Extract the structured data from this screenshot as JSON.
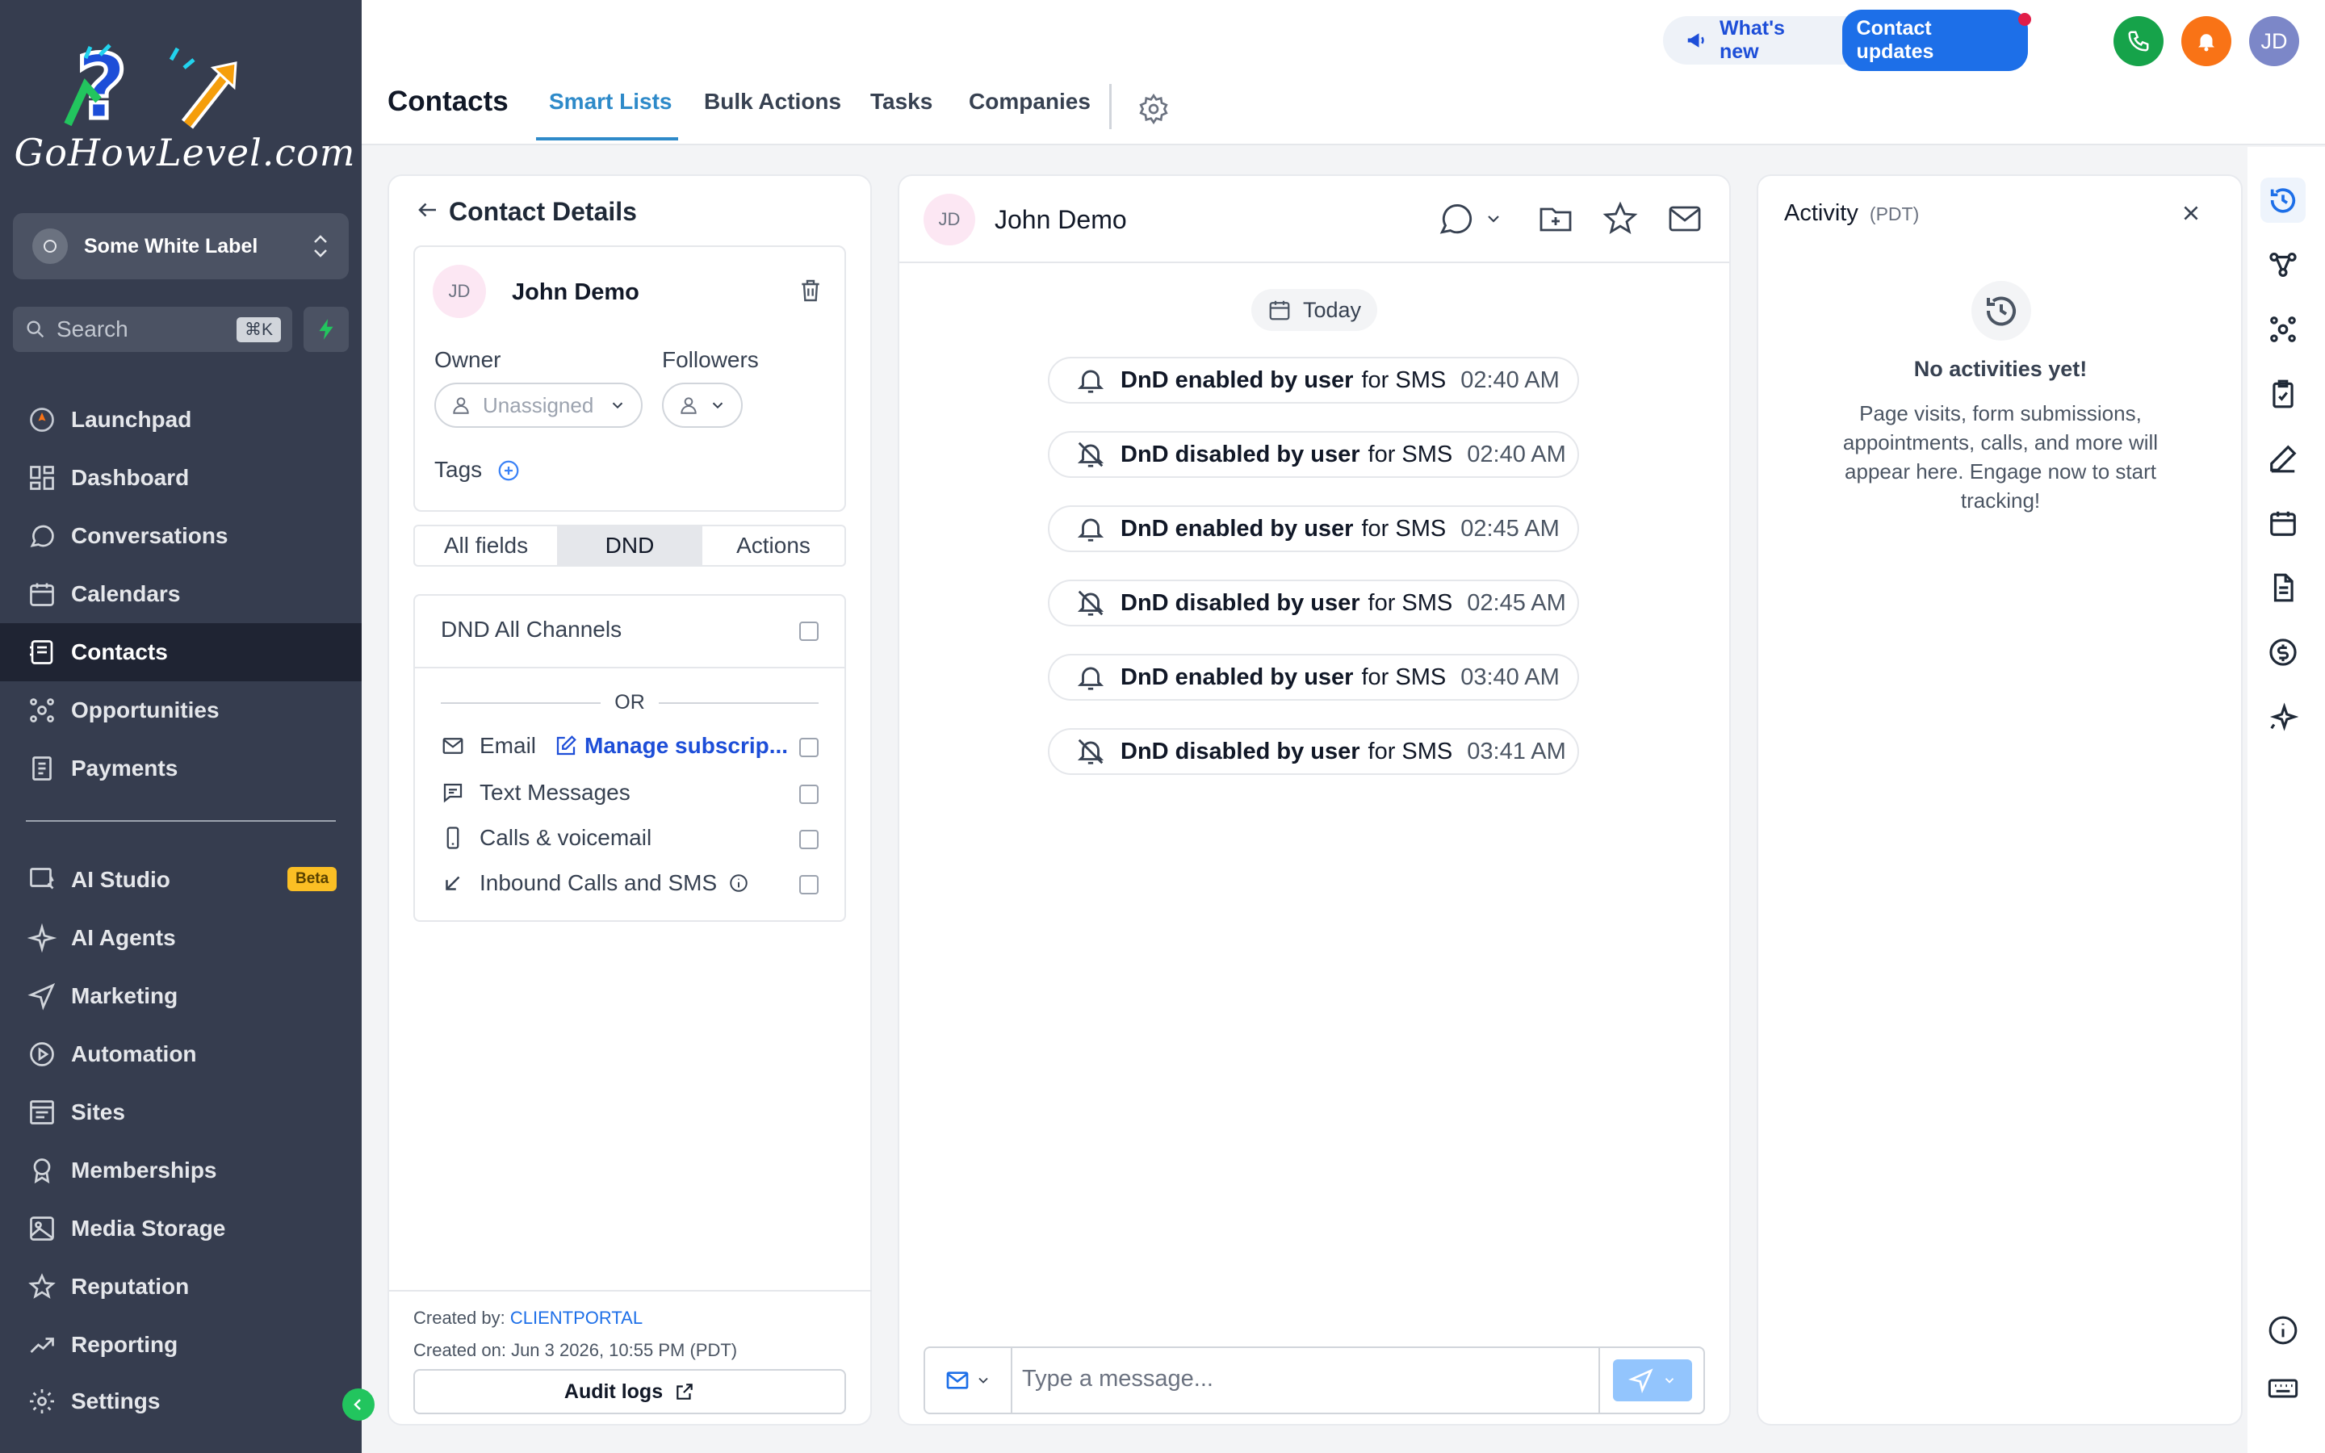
{
  "brand": {
    "logo_text": "GoHowLevel.com"
  },
  "sidebar": {
    "account": "Some White Label",
    "search_placeholder": "Search",
    "search_shortcut": "⌘K",
    "items": [
      {
        "label": "Launchpad",
        "icon": "rocket-icon"
      },
      {
        "label": "Dashboard",
        "icon": "grid-icon"
      },
      {
        "label": "Conversations",
        "icon": "chat-icon"
      },
      {
        "label": "Calendars",
        "icon": "calendar-icon"
      },
      {
        "label": "Contacts",
        "icon": "contacts-icon",
        "active": true
      },
      {
        "label": "Opportunities",
        "icon": "opportunities-icon"
      },
      {
        "label": "Payments",
        "icon": "payments-icon"
      },
      {
        "label": "AI Studio",
        "icon": "ai-studio-icon",
        "badge": "Beta"
      },
      {
        "label": "AI Agents",
        "icon": "sparkle-icon"
      },
      {
        "label": "Marketing",
        "icon": "send-icon"
      },
      {
        "label": "Automation",
        "icon": "automation-icon"
      },
      {
        "label": "Sites",
        "icon": "sites-icon"
      },
      {
        "label": "Memberships",
        "icon": "memberships-icon"
      },
      {
        "label": "Media Storage",
        "icon": "image-icon"
      },
      {
        "label": "Reputation",
        "icon": "star-icon"
      },
      {
        "label": "Reporting",
        "icon": "trend-icon"
      },
      {
        "label": "Settings",
        "icon": "gear-icon"
      }
    ]
  },
  "header": {
    "title": "Contacts",
    "tabs": [
      "Smart Lists",
      "Bulk Actions",
      "Tasks",
      "Companies"
    ],
    "active_tab": "Smart Lists",
    "whats_new": "What's new",
    "contact_updates": "Contact updates",
    "user_initials": "JD"
  },
  "contact_panel": {
    "title": "Contact Details",
    "initials": "JD",
    "name": "John Demo",
    "owner_label": "Owner",
    "owner_value": "Unassigned",
    "followers_label": "Followers",
    "tags_label": "Tags",
    "segments": [
      "All fields",
      "DND",
      "Actions"
    ],
    "active_segment": "DND",
    "dnd": {
      "all_channels": "DND All Channels",
      "or": "OR",
      "email": "Email",
      "manage": "Manage subscrip...",
      "text": "Text Messages",
      "calls": "Calls & voicemail",
      "inbound": "Inbound Calls and SMS"
    },
    "created_by_label": "Created by:",
    "created_by": "CLIENTPORTAL",
    "created_on": "Created on: Jun 3 2026, 10:55 PM (PDT)",
    "audit_logs": "Audit logs"
  },
  "conversation": {
    "initials": "JD",
    "name": "John Demo",
    "date_label": "Today",
    "events": [
      {
        "bold": "DnD enabled by user",
        "rest": "for SMS",
        "time": "02:40 AM",
        "type": "enabled"
      },
      {
        "bold": "DnD disabled by user",
        "rest": "for SMS",
        "time": "02:40 AM",
        "type": "disabled"
      },
      {
        "bold": "DnD enabled by user",
        "rest": "for SMS",
        "time": "02:45 AM",
        "type": "enabled"
      },
      {
        "bold": "DnD disabled by user",
        "rest": "for SMS",
        "time": "02:45 AM",
        "type": "disabled"
      },
      {
        "bold": "DnD enabled by user",
        "rest": "for SMS",
        "time": "03:40 AM",
        "type": "enabled"
      },
      {
        "bold": "DnD disabled by user",
        "rest": "for SMS",
        "time": "03:41 AM",
        "type": "disabled"
      }
    ],
    "message_placeholder": "Type a message..."
  },
  "activity": {
    "title": "Activity",
    "tz": "(PDT)",
    "empty_title": "No activities yet!",
    "empty_body": "Page visits, form submissions, appointments, calls, and more will appear here. Engage now to start tracking!"
  },
  "colors": {
    "sidebar_bg": "#363d4f",
    "accent": "#2e8ac9",
    "phone": "#16a34a",
    "bell": "#f97316",
    "badge": "#fbbf24"
  }
}
